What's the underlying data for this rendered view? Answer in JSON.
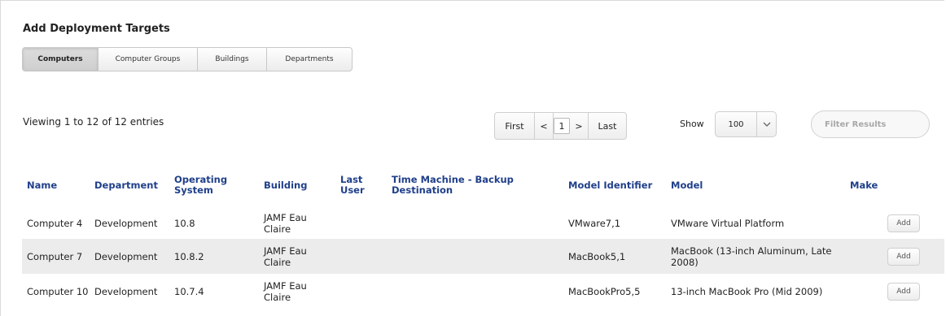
{
  "title": "Add Deployment Targets",
  "tabs": [
    {
      "label": "Computers",
      "active": true
    },
    {
      "label": "Computer Groups",
      "active": false
    },
    {
      "label": "Buildings",
      "active": false
    },
    {
      "label": "Departments",
      "active": false
    }
  ],
  "viewing": "Viewing 1 to 12 of 12 entries",
  "pagination": {
    "first": "First",
    "prev": "<",
    "current": "1",
    "next": ">",
    "last": "Last"
  },
  "show": {
    "label": "Show",
    "value": "100"
  },
  "filter": {
    "placeholder": "Filter Results"
  },
  "columns": [
    "Name",
    "Department",
    "Operating System",
    "Building",
    "Last User",
    "Time Machine - Backup Destination",
    "Model Identifier",
    "Model",
    "Make"
  ],
  "rows": [
    {
      "name": "Computer 4",
      "department": "Development",
      "os": "10.8",
      "building": "JAMF Eau Claire",
      "last_user": "",
      "time_machine": "",
      "model_id": "VMware7,1",
      "model": "VMware Virtual Platform",
      "make": "",
      "action": "Add"
    },
    {
      "name": "Computer 7",
      "department": "Development",
      "os": "10.8.2",
      "building": "JAMF Eau Claire",
      "last_user": "",
      "time_machine": "",
      "model_id": "MacBook5,1",
      "model": "MacBook (13-inch Aluminum, Late 2008)",
      "make": "",
      "action": "Add"
    },
    {
      "name": "Computer 10",
      "department": "Development",
      "os": "10.7.4",
      "building": "JAMF Eau Claire",
      "last_user": "",
      "time_machine": "",
      "model_id": "MacBookPro5,5",
      "model": "13-inch MacBook Pro (Mid 2009)",
      "make": "",
      "action": "Add"
    }
  ]
}
